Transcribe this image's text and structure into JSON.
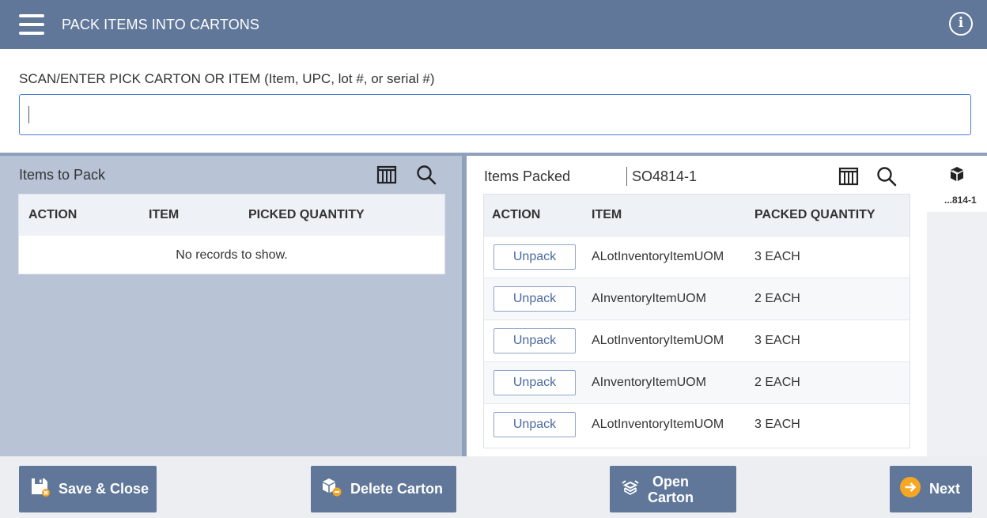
{
  "header": {
    "title": "PACK ITEMS INTO CARTONS",
    "menu_icon": "hamburger-menu-icon",
    "info_icon": "info-icon",
    "info_glyph": "i"
  },
  "scan": {
    "label": "SCAN/ENTER PICK CARTON OR ITEM (Item, UPC, lot #, or serial #)",
    "value": "",
    "placeholder": ""
  },
  "items_to_pack": {
    "title": "Items to Pack",
    "columns": [
      "ACTION",
      "ITEM",
      "PICKED QUANTITY"
    ],
    "empty_message": "No records to show.",
    "column_chooser_icon": "column-chooser-icon",
    "search_icon": "search-icon"
  },
  "items_packed": {
    "title": "Items Packed",
    "carton_id": "SO4814-1",
    "columns": [
      "ACTION",
      "ITEM",
      "PACKED QUANTITY"
    ],
    "column_chooser_icon": "column-chooser-icon",
    "search_icon": "search-icon",
    "rows": [
      {
        "action": "Unpack",
        "item": "ALotInventoryItemUOM",
        "qty": "3 EACH"
      },
      {
        "action": "Unpack",
        "item": "AInventoryItemUOM",
        "qty": "2 EACH"
      },
      {
        "action": "Unpack",
        "item": "ALotInventoryItemUOM",
        "qty": "3 EACH"
      },
      {
        "action": "Unpack",
        "item": "AInventoryItemUOM",
        "qty": "2 EACH"
      },
      {
        "action": "Unpack",
        "item": "ALotInventoryItemUOM",
        "qty": "3 EACH"
      }
    ]
  },
  "carton_tab": {
    "icon": "carton-box-icon",
    "label": "...814-1"
  },
  "footer": {
    "save_close": "Save & Close",
    "delete_carton": "Delete Carton",
    "open_carton_line1": "Open",
    "open_carton_line2": "Carton",
    "next": "Next"
  },
  "colors": {
    "header_bg": "#607799",
    "button_bg": "#607799",
    "next_icon": "#f5a623",
    "input_border": "#4a7fd6"
  }
}
